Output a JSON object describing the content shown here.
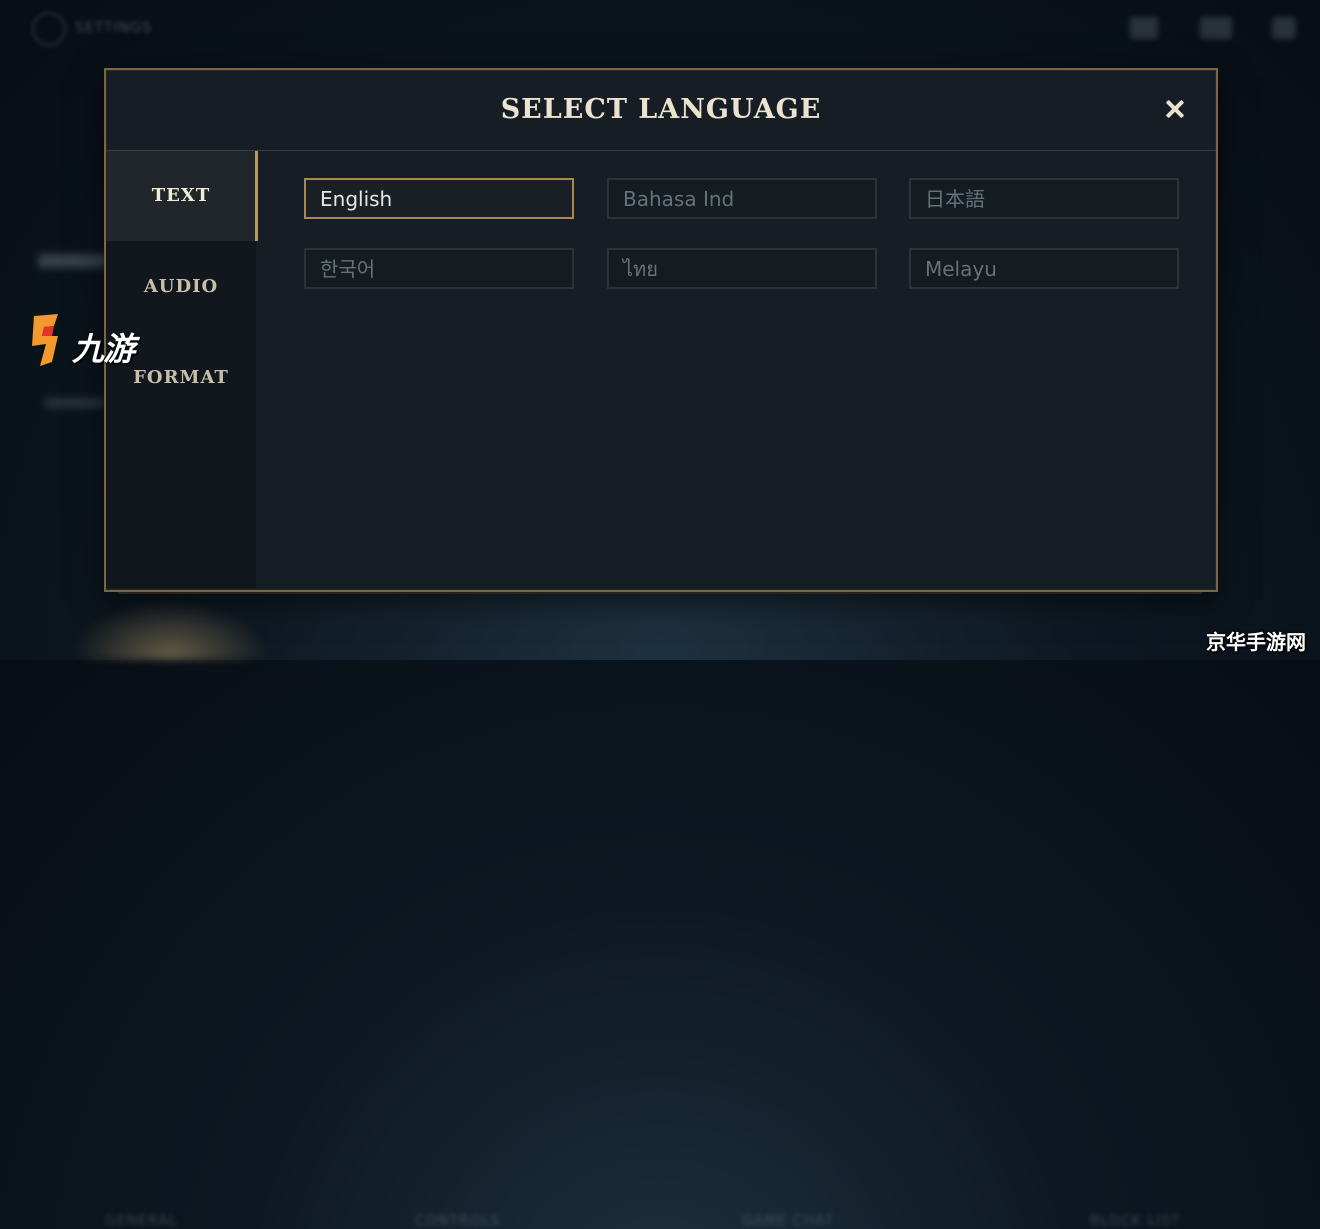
{
  "background": {
    "title": "SETTINGS",
    "tabs": [
      "GENERAL",
      "CONTROLS",
      "GAME CHAT",
      "BLOCK LIST"
    ]
  },
  "dialog": {
    "title": "SELECT LANGUAGE",
    "close_icon": "close-icon",
    "tabs": [
      {
        "label": "TEXT",
        "active": true
      },
      {
        "label": "AUDIO",
        "active": false
      },
      {
        "label": "FORMAT",
        "active": false
      }
    ],
    "languages": [
      {
        "label": "English",
        "selected": true
      },
      {
        "label": "Bahasa Ind",
        "selected": false
      },
      {
        "label": "日本語",
        "selected": false
      },
      {
        "label": "한국어",
        "selected": false
      },
      {
        "label": "ไทย",
        "selected": false
      },
      {
        "label": "Melayu",
        "selected": false
      }
    ]
  },
  "watermarks": {
    "left": "九游",
    "right": "京华手游网"
  },
  "colors": {
    "accent_gold": "#a88a4e",
    "title_text": "#ece3cf",
    "panel_bg": "#161d24"
  }
}
